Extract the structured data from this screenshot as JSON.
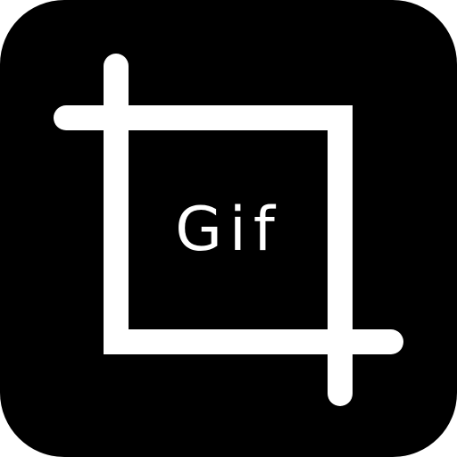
{
  "icon": {
    "name": "crop-gif-icon",
    "background_color": "#000000",
    "foreground_color": "#ffffff"
  },
  "label": {
    "text": "Gif"
  }
}
